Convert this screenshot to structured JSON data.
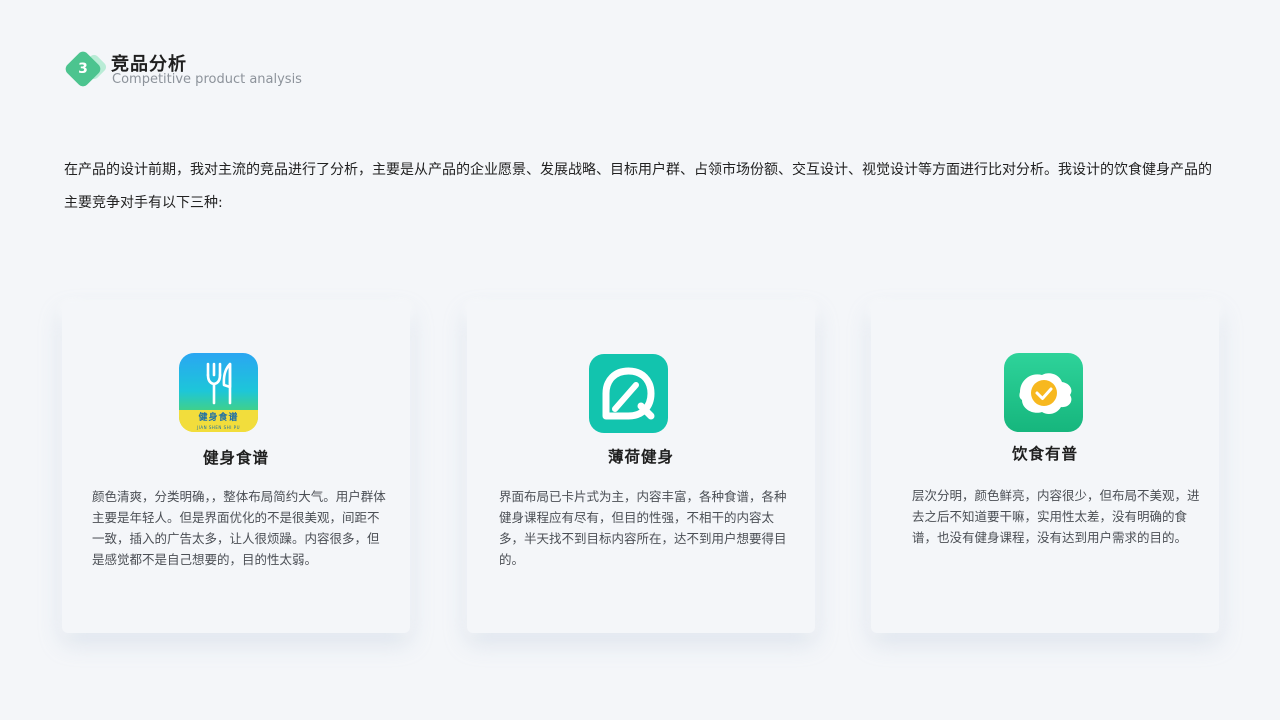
{
  "section": {
    "number": "3",
    "title": "竞品分析",
    "subtitle": "Competitive product analysis"
  },
  "intro": "在产品的设计前期，我对主流的竞品进行了分析，主要是从产品的企业愿景、发展战略、目标用户群、占领市场份额、交互设计、视觉设计等方面进行比对分析。我设计的饮食健身产品的主要竞争对手有以下三种:",
  "competitors": [
    {
      "name": "健身食谱",
      "icon": "fork-knife-icon",
      "icon_label": "健身食谱",
      "icon_sublabel": "JIAN SHEN SHI PU",
      "description": "颜色清爽，分类明确，，整体布局简约大气。用户群体主要是年轻人。但是界面优化的不是很美观，间距不一致，插入的广告太多，让人很烦躁。内容很多，但是感觉都不是自己想要的，目的性太弱。"
    },
    {
      "name": "薄荷健身",
      "icon": "mint-leaf-icon",
      "description": "界面布局已卡片式为主，内容丰富，各种食谱，各种健身课程应有尽有，但目的性强，不相干的内容太多，半天找不到目标内容所在，达不到用户想要得目的。"
    },
    {
      "name": "饮食有普",
      "icon": "fried-egg-check-icon",
      "description": "层次分明，颜色鲜亮，内容很少，但布局不美观，进去之后不知道要干嘛，实用性太差，没有明确的食谱，也没有健身课程，没有达到用户需求的目的。"
    }
  ],
  "colors": {
    "background": "#f4f6f9",
    "accent_green": "#4cc48f",
    "mint_teal": "#12c4ae",
    "egg_green": "#1fc48a"
  }
}
